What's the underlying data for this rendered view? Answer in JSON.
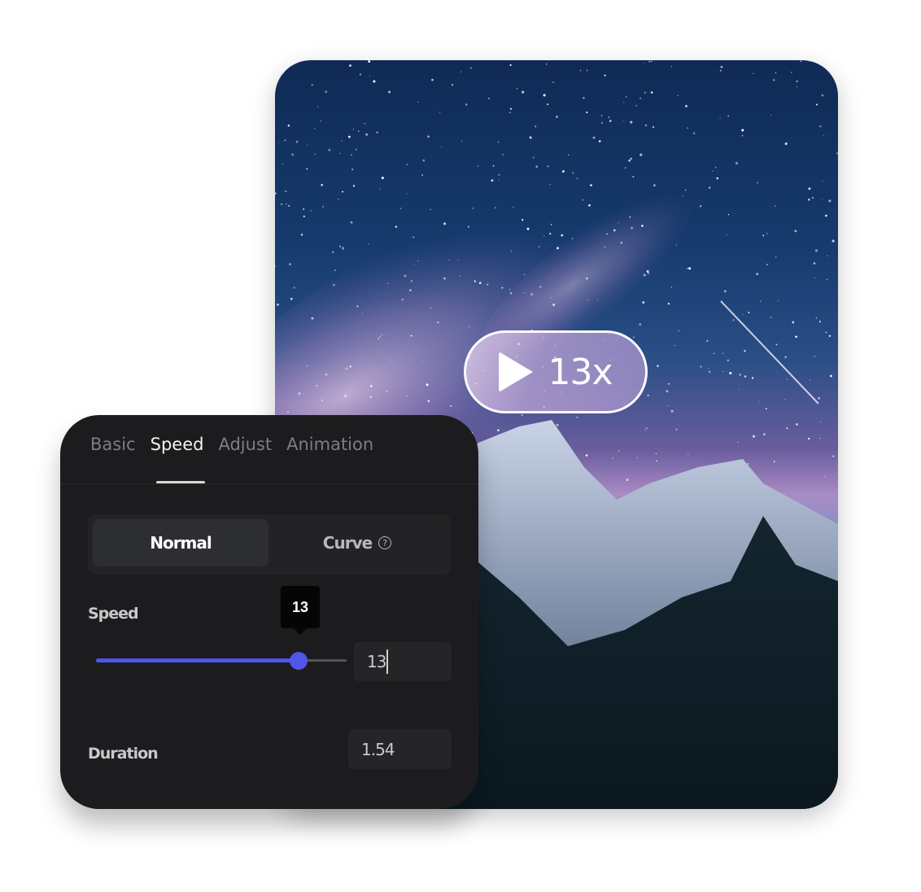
{
  "preview": {
    "speed_badge": {
      "icon": "play-icon",
      "label": "13x"
    }
  },
  "panel": {
    "tabs": [
      {
        "label": "Basic",
        "active": false
      },
      {
        "label": "Speed",
        "active": true
      },
      {
        "label": "Adjust",
        "active": false
      },
      {
        "label": "Animation",
        "active": false
      }
    ],
    "mode": {
      "options": [
        {
          "label": "Normal",
          "selected": true
        },
        {
          "label": "Curve",
          "selected": false,
          "icon": "help-icon"
        }
      ],
      "help_glyph": "?"
    },
    "speed": {
      "label": "Speed",
      "tooltip": "13",
      "slider_fraction": 0.81,
      "input_value": "13"
    },
    "duration": {
      "label": "Duration",
      "input_value": "1.54"
    }
  },
  "colors": {
    "accent": "#4f56e8",
    "panel_bg": "#1c1c1e"
  }
}
